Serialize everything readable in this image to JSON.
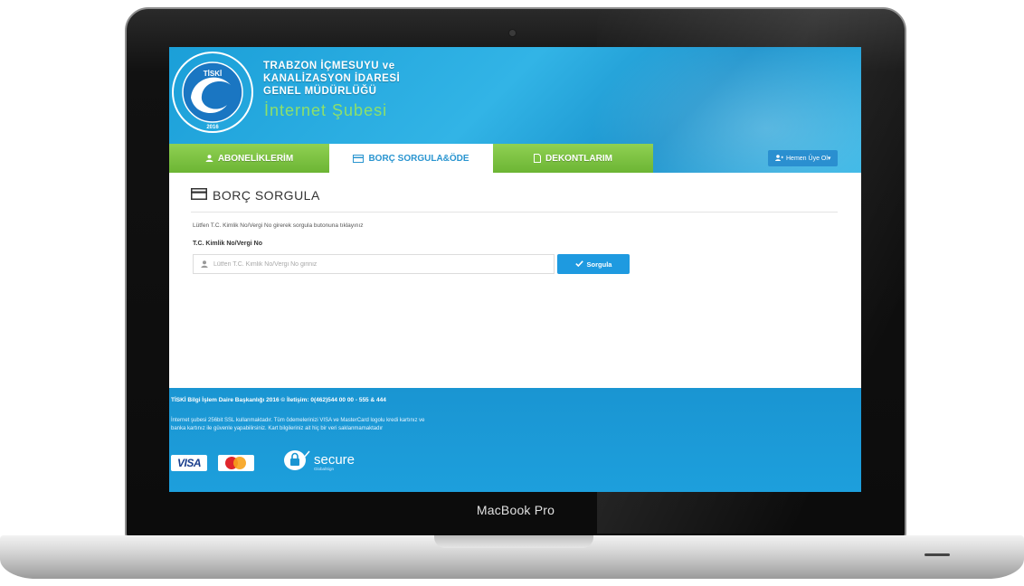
{
  "device": {
    "brand_label": "MacBook Pro"
  },
  "header": {
    "logo_text": "TİSKİ",
    "logo_year": "2016",
    "org_line1": "TRABZON İÇMESUYU ve",
    "org_line2": "KANALİZASYON İDARESİ",
    "org_line3": "GENEL MÜDÜRLÜĞÜ",
    "subtitle": "İnternet Şubesi"
  },
  "tabs": [
    {
      "label": "ABONELİKLERİM",
      "icon": "users-icon",
      "active": false
    },
    {
      "label": "BORÇ SORGULA&ÖDE",
      "icon": "credit-card-icon",
      "active": true
    },
    {
      "label": "DEKONTLARIM",
      "icon": "document-icon",
      "active": false
    }
  ],
  "member_button": {
    "label": "Hemen Üye Ol▾",
    "icon": "user-add-icon"
  },
  "panel": {
    "title": "BORÇ SORGULA",
    "hint": "Lütfen T.C. Kimlik No/Vergi No girerek sorgula butonuna tıklayınız",
    "field_label": "T.C. Kimlik No/Vergi No",
    "input_value": "",
    "input_placeholder": "Lütfen T.C. Kimlik No/Vergi No giriniz",
    "submit_label": "Sorgula"
  },
  "footer": {
    "line1": "TİSKİ Bilgi İşlem Daire Başkanlığı 2016 © İletişim: 0(462)544 00 00 - 555 & 444",
    "line2": "İnternet şubesi 256bit SSL kullanmaktadır. Tüm ödemelerinizi VISA ve MasterCard logolu kredi kartınız ve",
    "line3": "banka kartınız ile güvenle yapabilirsiniz. Kart bilgileriniz ait hiç bir veri saklanmamaktadır",
    "visa_label": "VISA",
    "secure_label": "secure",
    "secure_sub": "GlobalSign"
  },
  "colors": {
    "header_blue": "#1b9fd8",
    "tab_green": "#7cc243",
    "active_tab_text": "#2a95d0",
    "button_blue": "#1e9ae0",
    "subtitle_green": "#8ee06a"
  }
}
